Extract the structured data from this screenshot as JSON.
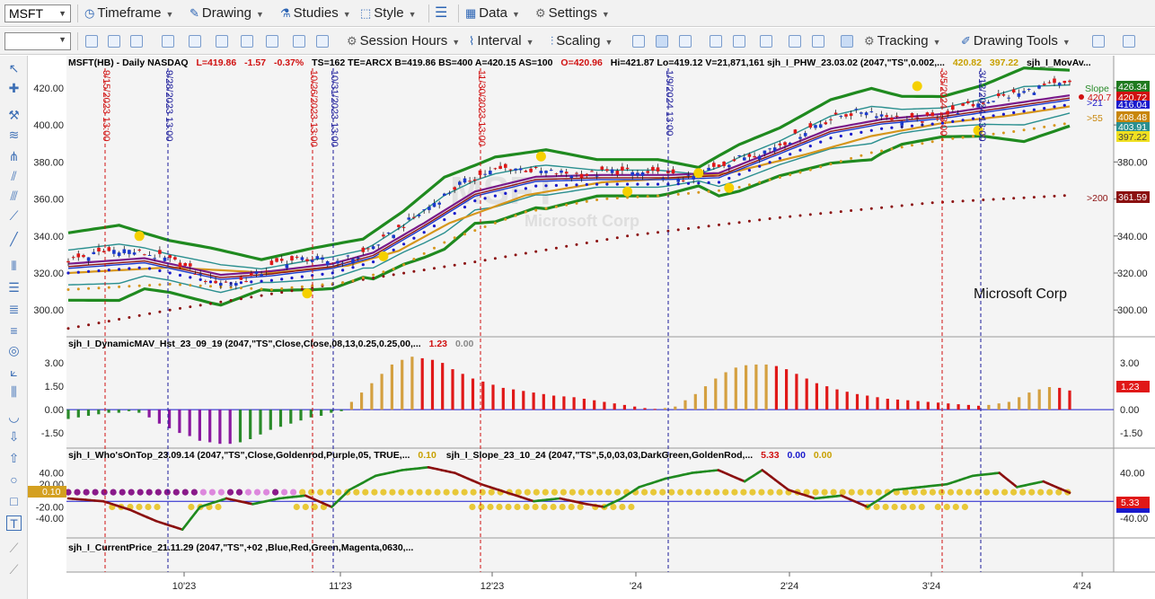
{
  "toolbar1": {
    "symbol": "MSFT",
    "items": [
      "Timeframe",
      "Drawing",
      "Studies",
      "Style",
      "Data",
      "Settings"
    ]
  },
  "toolbar2": {
    "items": [
      "Session Hours",
      "Interval",
      "Scaling",
      "Tracking",
      "Drawing Tools"
    ]
  },
  "header": {
    "symbol": "MSFT(HB) - Daily  NASDAQ",
    "last": "L=419.86",
    "chg": "-1.57",
    "pct": "-0.37%",
    "info1": "TS=162  TE=ARCX  B=419.86  BS=400  A=420.15  AS=100",
    "open": "O=420.96",
    "info2": "Hi=421.87  Lo=419.12  V=21,871,161  sjh_I_PHW_23.03.02 (2047,\"TS\",0.002,...",
    "val1": "420.82",
    "val2": "397.22",
    "info3": "sjh_I_MovAv..."
  },
  "subpanes": {
    "p2": {
      "title": "sjh_I_DynamicMAV_Hst_23_09_19 (2047,\"TS\",Close,Close,08,13,0.25,0.25,00,...",
      "v1": "1.23",
      "v2": "0.00",
      "tag": "1.23"
    },
    "p3": {
      "title": "sjh_I_Who'sOnTop_23.09.14 (2047,\"TS\",Close,Goldenrod,Purple,05,  TRUE,...",
      "v1": "0.10",
      "title2": "sjh_I_Slope_23_10_24 (2047,\"TS\",5,0,03,03,DarkGreen,GoldenRod,...",
      "v2": "5.33",
      "v3": "0.00",
      "v4": "0.00",
      "tagL": "0.10",
      "tagR": "5.33"
    },
    "p4": {
      "title": "sjh_I_CurrentPrice_21.11.29 (2047,\"TS\",+02 ,Blue,Red,Green,Magenta,0630,..."
    }
  },
  "watermark": {
    "symbol": "MSFT",
    "name": "Microsoft Corp",
    "label": "Microsoft Corp"
  },
  "right_tags": {
    "slope": "Slope",
    "p1": "420.7",
    "ma21": ">21",
    "ma55": ">55",
    "ma200": ">200",
    "v426": "426.34",
    "v420": "420.72",
    "v416": "416.04",
    "v408": "408.48",
    "v403": "403.91",
    "v397": "397.22",
    "v361": "361.59"
  },
  "vlines": [
    {
      "label": "9/15/2023 13:00",
      "color": "#d01010"
    },
    {
      "label": "9/28/2023 13:00",
      "color": "#1a1a9a"
    },
    {
      "label": "10/26/2023 13:00",
      "color": "#d01010"
    },
    {
      "label": "10/31/2023 13:00",
      "color": "#1a1a9a"
    },
    {
      "label": "11/30/2023 13:00",
      "color": "#d01010"
    },
    {
      "label": "1/9/2024 13:00",
      "color": "#1a1a9a"
    },
    {
      "label": "3/5/2024 13:00",
      "color": "#d01010"
    },
    {
      "label": "3/12/2024 13:00",
      "color": "#1a1a9a"
    }
  ],
  "chart_data": [
    {
      "type": "candlestick",
      "name": "price",
      "ylim": [
        287,
        435
      ],
      "yticks": [
        "300.00",
        "320.00",
        "340.00",
        "360.00",
        "380.00",
        "400.00",
        "420.00"
      ],
      "xticks": [
        "10'23",
        "11'23",
        "12'23",
        "'24",
        "2'24",
        "3'24",
        "4'24"
      ],
      "close_pts": [
        [
          0,
          327
        ],
        [
          10,
          333
        ],
        [
          16,
          330
        ],
        [
          22,
          325
        ],
        [
          27,
          317
        ],
        [
          32,
          314
        ],
        [
          37,
          319
        ],
        [
          42,
          326
        ],
        [
          47,
          328
        ],
        [
          52,
          326
        ],
        [
          57,
          329
        ],
        [
          62,
          338
        ],
        [
          67,
          348
        ],
        [
          72,
          358
        ],
        [
          77,
          368
        ],
        [
          82,
          374
        ],
        [
          87,
          377
        ],
        [
          92,
          375
        ],
        [
          97,
          374
        ],
        [
          102,
          373
        ],
        [
          107,
          375
        ],
        [
          112,
          374
        ],
        [
          117,
          373
        ],
        [
          122,
          371
        ],
        [
          127,
          377
        ],
        [
          132,
          382
        ],
        [
          137,
          386
        ],
        [
          142,
          392
        ],
        [
          147,
          400
        ],
        [
          152,
          405
        ],
        [
          157,
          408
        ],
        [
          162,
          404
        ],
        [
          167,
          402
        ],
        [
          172,
          405
        ],
        [
          177,
          410
        ],
        [
          182,
          414
        ],
        [
          187,
          417
        ],
        [
          192,
          421
        ],
        [
          197,
          422
        ]
      ],
      "ma21_pts": [
        [
          0,
          324
        ],
        [
          15,
          327
        ],
        [
          30,
          318
        ],
        [
          40,
          320
        ],
        [
          52,
          324
        ],
        [
          60,
          330
        ],
        [
          70,
          346
        ],
        [
          80,
          363
        ],
        [
          92,
          371
        ],
        [
          105,
          372
        ],
        [
          118,
          372
        ],
        [
          128,
          373
        ],
        [
          140,
          386
        ],
        [
          150,
          397
        ],
        [
          160,
          402
        ],
        [
          172,
          405
        ],
        [
          182,
          409
        ],
        [
          197,
          415
        ]
      ],
      "ma55_pts": [
        [
          0,
          318
        ],
        [
          20,
          321
        ],
        [
          40,
          318
        ],
        [
          55,
          322
        ],
        [
          65,
          330
        ],
        [
          75,
          345
        ],
        [
          90,
          360
        ],
        [
          105,
          367
        ],
        [
          118,
          369
        ],
        [
          130,
          372
        ],
        [
          145,
          382
        ],
        [
          158,
          392
        ],
        [
          172,
          399
        ],
        [
          185,
          403
        ],
        [
          197,
          408
        ]
      ],
      "ma200_pts": [
        [
          0,
          290
        ],
        [
          20,
          300
        ],
        [
          50,
          313
        ],
        [
          80,
          326
        ],
        [
          110,
          340
        ],
        [
          140,
          350
        ],
        [
          170,
          358
        ],
        [
          197,
          362
        ]
      ],
      "pbands_pts": [
        [
          0,
          338
        ],
        [
          10,
          342
        ],
        [
          20,
          334
        ],
        [
          28,
          330
        ],
        [
          38,
          324
        ],
        [
          48,
          330
        ],
        [
          58,
          335
        ],
        [
          66,
          350
        ],
        [
          74,
          368
        ],
        [
          84,
          379
        ],
        [
          94,
          383
        ],
        [
          104,
          378
        ],
        [
          116,
          378
        ],
        [
          124,
          374
        ],
        [
          132,
          386
        ],
        [
          140,
          395
        ],
        [
          150,
          410
        ],
        [
          158,
          416
        ],
        [
          164,
          412
        ],
        [
          172,
          412
        ],
        [
          180,
          418
        ],
        [
          188,
          427
        ],
        [
          197,
          426
        ]
      ]
    },
    {
      "type": "bar",
      "name": "sjh_I_DynamicMAV_Hst",
      "ylim": [
        -2.3,
        3.7
      ],
      "yticks": [
        "3.00",
        "1.50",
        "0.00",
        "-1.50"
      ],
      "values": [
        -0.6,
        -0.5,
        -0.4,
        -0.3,
        -0.2,
        -0.2,
        -0.1,
        -0.2,
        -0.5,
        -0.9,
        -1.2,
        -1.5,
        -1.7,
        -2.0,
        -2.1,
        -2.2,
        -2.2,
        -2.1,
        -1.9,
        -1.6,
        -1.3,
        -1.1,
        -0.9,
        -0.7,
        -0.5,
        -0.4,
        -0.2,
        -0.1,
        0.5,
        1.1,
        1.7,
        2.3,
        2.9,
        3.2,
        3.4,
        3.3,
        3.2,
        3.0,
        2.6,
        2.3,
        2.0,
        1.8,
        1.6,
        1.4,
        1.3,
        1.2,
        1.1,
        1.0,
        0.9,
        0.85,
        0.8,
        0.7,
        0.6,
        0.5,
        0.4,
        0.3,
        0.2,
        0.1,
        0.05,
        0.1,
        0.2,
        0.6,
        1.0,
        1.5,
        2.0,
        2.4,
        2.7,
        2.85,
        2.9,
        2.9,
        2.8,
        2.6,
        2.3,
        2.0,
        1.7,
        1.5,
        1.3,
        1.15,
        1.0,
        0.9,
        0.8,
        0.7,
        0.65,
        0.6,
        0.55,
        0.5,
        0.45,
        0.4,
        0.35,
        0.3,
        0.25,
        0.3,
        0.4,
        0.5,
        0.8,
        1.1,
        1.3,
        1.45,
        1.4,
        1.23
      ]
    },
    {
      "type": "line",
      "name": "sjh_I_Slope",
      "ylim": [
        -70,
        60
      ],
      "yticks": [
        "40.00",
        "20.00",
        "-20.00",
        "-40.00"
      ],
      "pts": [
        [
          0,
          -5
        ],
        [
          8,
          -10
        ],
        [
          14,
          -25
        ],
        [
          20,
          -45
        ],
        [
          26,
          -60
        ],
        [
          30,
          -20
        ],
        [
          36,
          -5
        ],
        [
          42,
          -15
        ],
        [
          48,
          -5
        ],
        [
          54,
          0
        ],
        [
          60,
          -20
        ],
        [
          64,
          10
        ],
        [
          70,
          35
        ],
        [
          76,
          45
        ],
        [
          82,
          50
        ],
        [
          88,
          40
        ],
        [
          94,
          20
        ],
        [
          100,
          5
        ],
        [
          106,
          -10
        ],
        [
          112,
          -5
        ],
        [
          118,
          -15
        ],
        [
          122,
          -20
        ],
        [
          126,
          -5
        ],
        [
          130,
          15
        ],
        [
          136,
          30
        ],
        [
          142,
          40
        ],
        [
          148,
          45
        ],
        [
          154,
          25
        ],
        [
          158,
          45
        ],
        [
          164,
          10
        ],
        [
          170,
          -5
        ],
        [
          176,
          0
        ],
        [
          182,
          -20
        ],
        [
          188,
          10
        ],
        [
          194,
          15
        ],
        [
          200,
          20
        ],
        [
          206,
          35
        ],
        [
          212,
          40
        ],
        [
          216,
          15
        ],
        [
          222,
          25
        ],
        [
          228,
          5
        ]
      ]
    }
  ]
}
